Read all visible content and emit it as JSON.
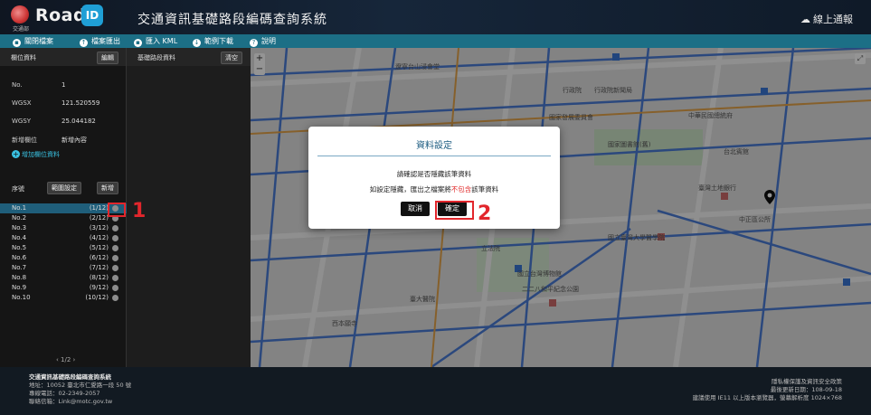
{
  "header": {
    "logo_caption": "交通部",
    "logo_word": "Road",
    "logo_badge": "ID",
    "title": "交通資訊基礎路段編碼查詢系統",
    "online_help": "線上通報"
  },
  "toolbar": {
    "items": [
      {
        "label": "關閉檔案",
        "icon": "file-icon"
      },
      {
        "label": "檔案匯出",
        "icon": "export-icon"
      },
      {
        "label": "匯入 KML",
        "icon": "import-icon"
      },
      {
        "label": "範例下載",
        "icon": "download-icon"
      },
      {
        "label": "說明",
        "icon": "help-icon"
      }
    ]
  },
  "left_panel": {
    "title": "欄位資料",
    "edit_label": "編輯",
    "fields": [
      {
        "key": "No.",
        "value": "1"
      },
      {
        "key": "WGSX",
        "value": "121.520559"
      },
      {
        "key": "WGSY",
        "value": "25.044182"
      },
      {
        "key": "新增欄位",
        "value": "新增內容"
      }
    ],
    "add_field_label": "增加欄位資料",
    "list_header": {
      "seq": "序號",
      "range_label": "範圍設定",
      "add_label": "新增"
    },
    "rows": [
      {
        "no": "No.1",
        "count": "(1/12)"
      },
      {
        "no": "No.2",
        "count": "(2/12)"
      },
      {
        "no": "No.3",
        "count": "(3/12)"
      },
      {
        "no": "No.4",
        "count": "(4/12)"
      },
      {
        "no": "No.5",
        "count": "(5/12)"
      },
      {
        "no": "No.6",
        "count": "(6/12)"
      },
      {
        "no": "No.7",
        "count": "(7/12)"
      },
      {
        "no": "No.8",
        "count": "(8/12)"
      },
      {
        "no": "No.9",
        "count": "(9/12)"
      },
      {
        "no": "No.10",
        "count": "(10/12)"
      }
    ],
    "pager": "1/2"
  },
  "mid_panel": {
    "title": "基礎路段資料",
    "clear_label": "清空"
  },
  "map": {
    "labels": [
      "遼寧台山浸會堂",
      "行政院",
      "行政院新聞局",
      "國家發展委員會",
      "中華民國總統府",
      "台北賓館",
      "國家圖書館(舊)",
      "臺灣土地銀行",
      "國立臺灣大學醫學院",
      "臺大醫院",
      "二二八和平紀念公園",
      "國立台灣博物館",
      "立法院",
      "中正區公所",
      "西本願寺"
    ]
  },
  "modal": {
    "title": "資料設定",
    "line1": "請確認是否隱藏該筆資料",
    "line2_pre": "如設定隱藏，匯出之檔案將",
    "line2_red": "不包含",
    "line2_post": "該筆資料",
    "cancel_label": "取消",
    "confirm_label": "確定"
  },
  "annotations": {
    "first": "1",
    "second": "2",
    "color": "#e2262c"
  },
  "footer": {
    "left_title": "交通資訊基礎路段編碼查詢系統",
    "left_addr": "地址：10052 臺北市仁愛路一段 50 號",
    "left_phone": "專線電話：02-2349-2057",
    "left_email": "聯絡信箱：Link@motc.gov.tw",
    "right_policy": "隱私權保護及資訊安全政策",
    "right_updated": "最後更新日期：108-09-18",
    "right_browser": "建議使用 IE11 以上版本瀏覽器，螢幕解析度 1024×768"
  }
}
